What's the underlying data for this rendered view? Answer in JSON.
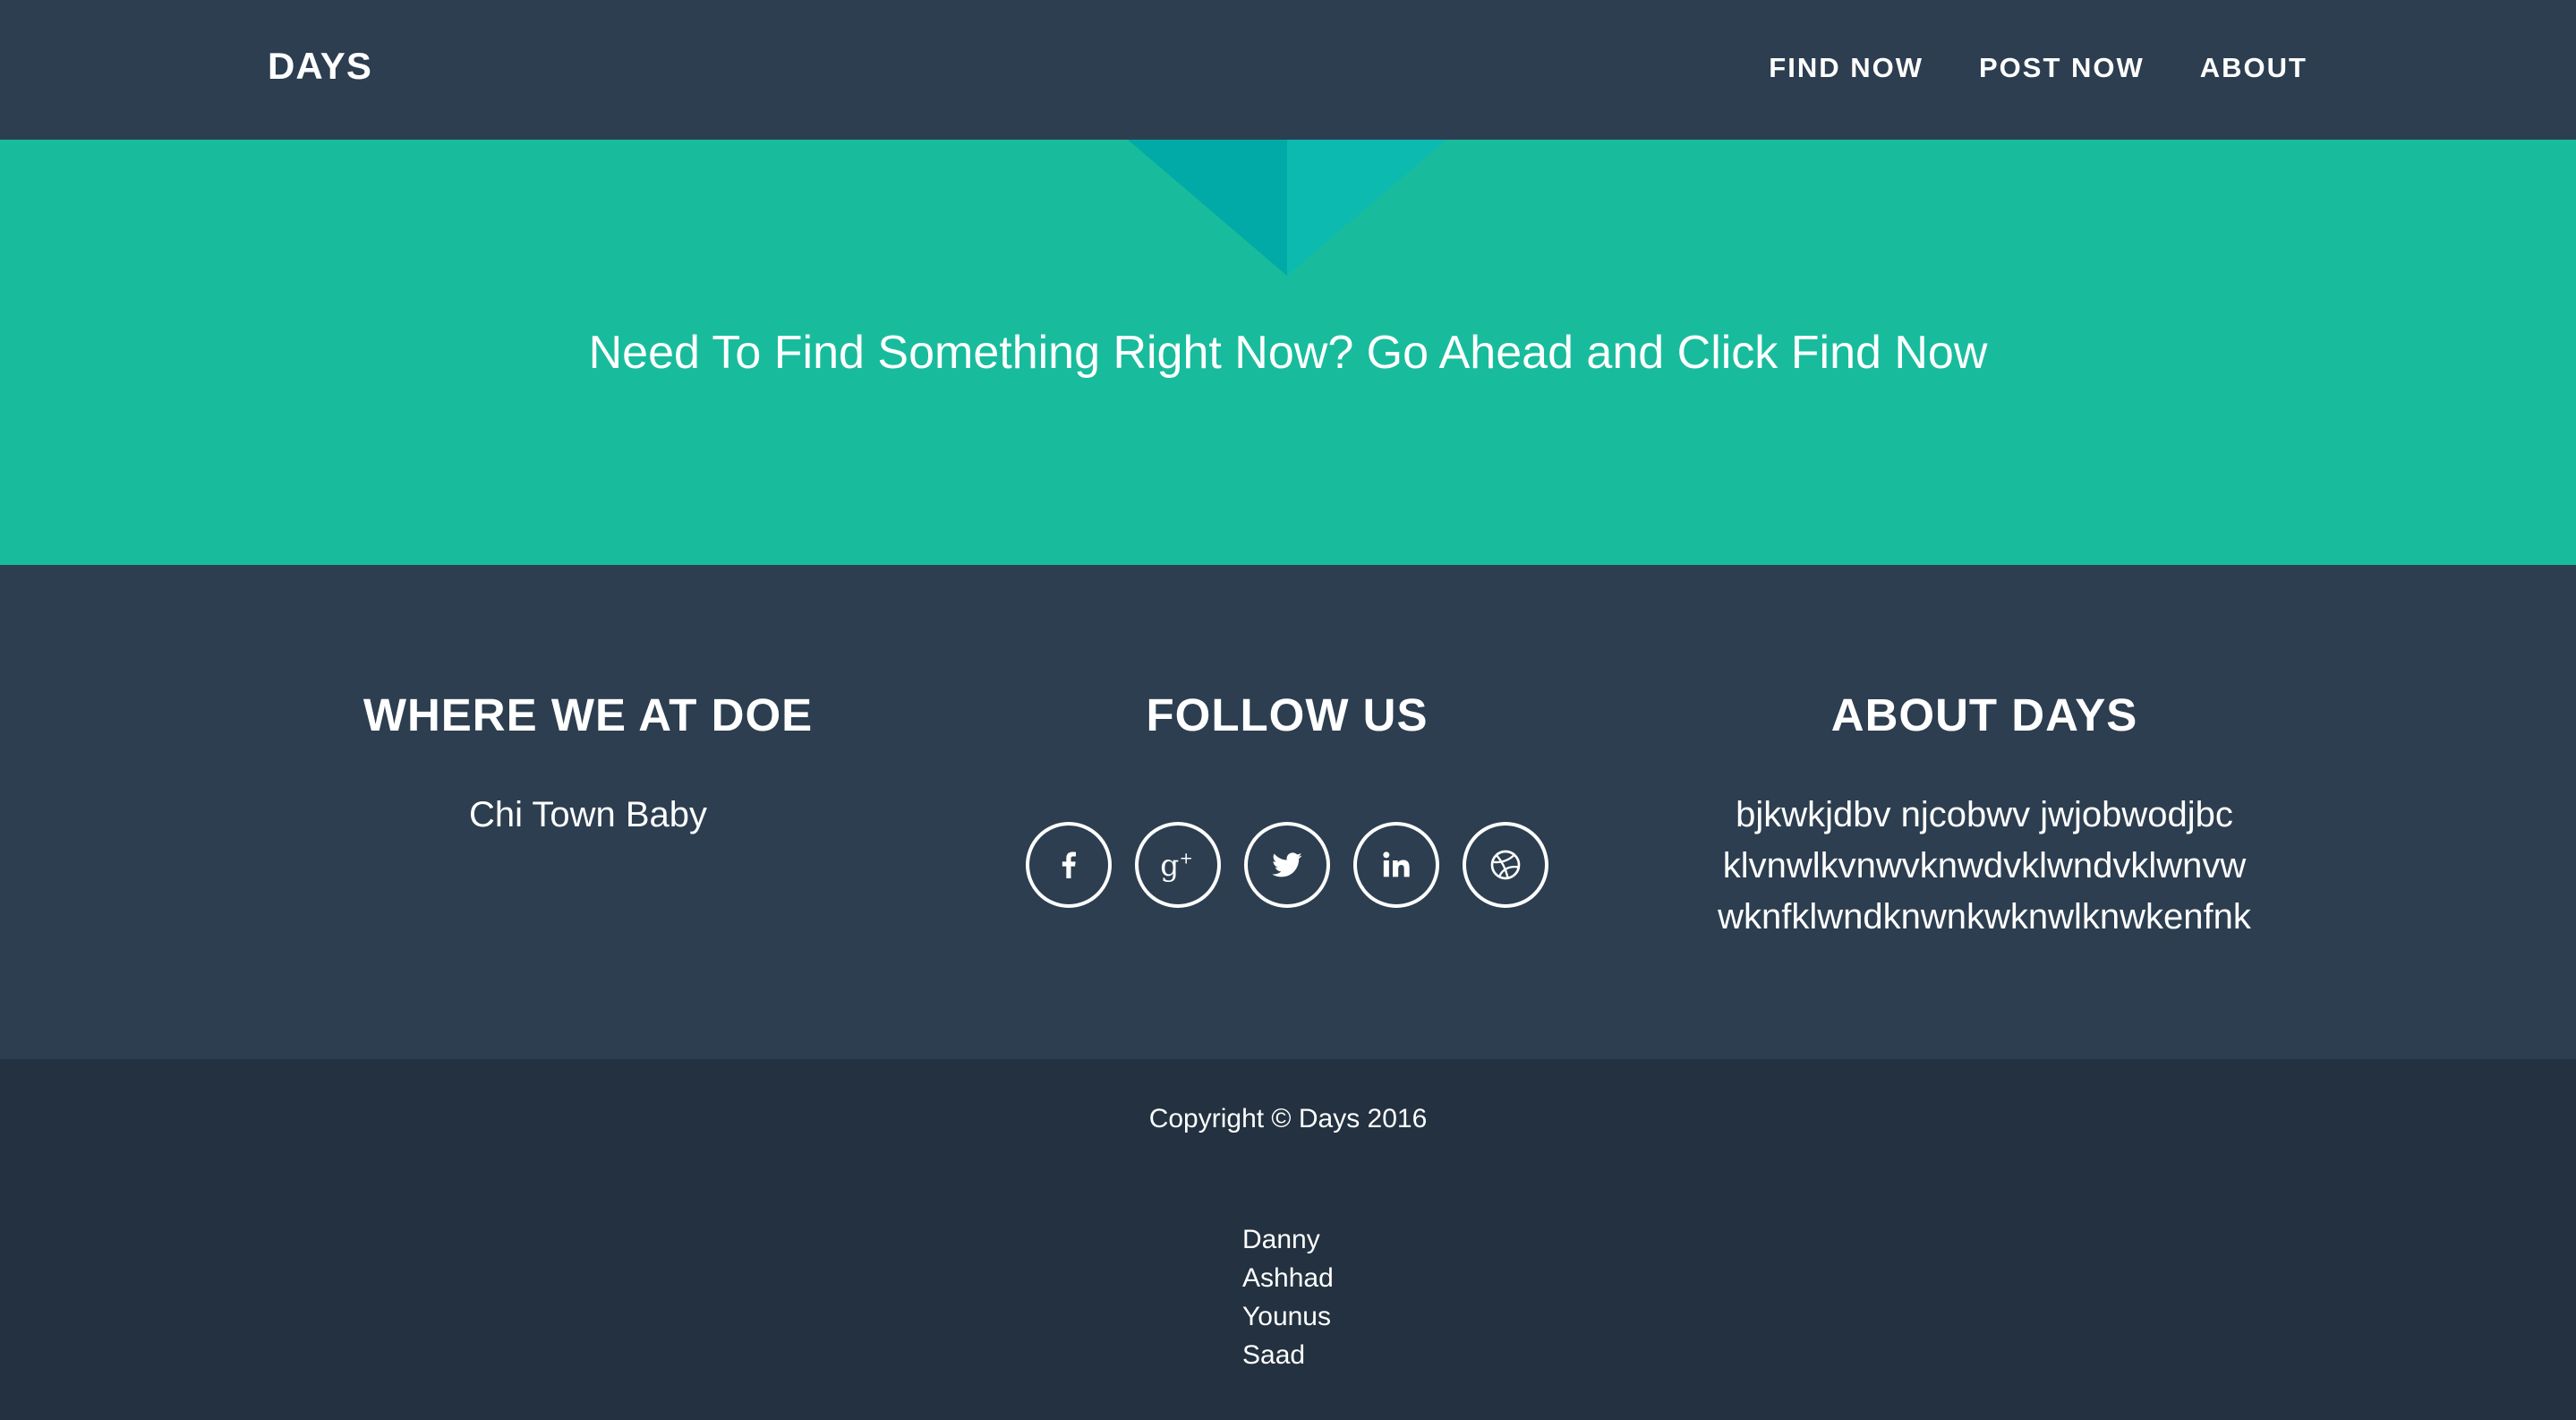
{
  "navbar": {
    "brand": "DAYS",
    "links": [
      "FIND NOW",
      "POST NOW",
      "ABOUT"
    ]
  },
  "hero": {
    "text": "Need To Find Something Right Now? Go Ahead and Click Find Now"
  },
  "footer": {
    "location": {
      "heading": "WHERE WE AT DOE",
      "text": "Chi Town Baby"
    },
    "follow": {
      "heading": "FOLLOW US",
      "icons": [
        "facebook-icon",
        "google-plus-icon",
        "twitter-icon",
        "linkedin-icon",
        "dribbble-icon"
      ]
    },
    "about": {
      "heading": "ABOUT DAYS",
      "lines": [
        "bjkwkjdbv njcobwv jwjobwodjbc",
        "klvnwlkvnwvknwdvklwndvklwnvw",
        "wknfklwndknwnkwknwlknwkenfnk"
      ]
    }
  },
  "bottom": {
    "copyright": "Copyright © Days 2016",
    "names": [
      "Danny",
      "Ashhad",
      "Younus",
      "Saad"
    ]
  },
  "colors": {
    "nav_bg": "#2c3e50",
    "hero_bg": "#18bc9c",
    "bottom_bg": "#233140"
  }
}
